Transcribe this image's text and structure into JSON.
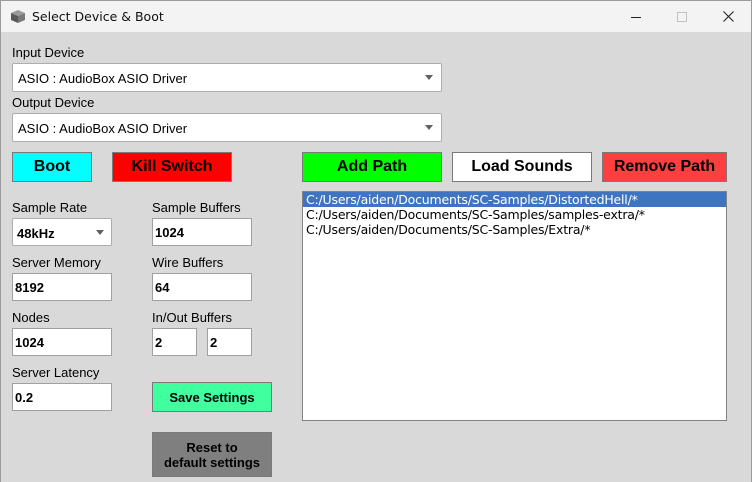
{
  "window": {
    "title": "Select Device & Boot",
    "icon": "app-cube-icon",
    "controls": [
      "minimize-icon",
      "maximize-icon",
      "close-icon"
    ]
  },
  "devices": {
    "input_label": "Input Device",
    "input_value": "ASIO : AudioBox ASIO Driver",
    "output_label": "Output Device",
    "output_value": "ASIO : AudioBox ASIO Driver"
  },
  "actions": {
    "boot": "Boot",
    "kill_switch": "Kill Switch",
    "add_path": "Add Path",
    "load_sounds": "Load Sounds",
    "remove_path": "Remove Path"
  },
  "settings": {
    "sample_rate_label": "Sample Rate",
    "sample_rate_value": "48kHz",
    "sample_buffers_label": "Sample Buffers",
    "sample_buffers_value": "1024",
    "server_memory_label": "Server Memory",
    "server_memory_value": "8192",
    "wire_buffers_label": "Wire Buffers",
    "wire_buffers_value": "64",
    "nodes_label": "Nodes",
    "nodes_value": "1024",
    "io_buffers_label": "In/Out Buffers",
    "in_buffers_value": "2",
    "out_buffers_value": "2",
    "server_latency_label": "Server Latency",
    "server_latency_value": "0.2",
    "save_label": "Save Settings",
    "reset_label_line1": "Reset to",
    "reset_label_line2": "default settings"
  },
  "paths": {
    "items": [
      "C:/Users/aiden/Documents/SC-Samples/DistortedHell/*",
      "C:/Users/aiden/Documents/SC-Samples/samples-extra/*",
      "C:/Users/aiden/Documents/SC-Samples/Extra/*"
    ],
    "selected_index": 0
  },
  "colors": {
    "boot": "#00ffff",
    "kill_switch": "#ff0000",
    "add_path": "#00ff00",
    "load_sounds": "#ffffff",
    "remove_path": "#ff3f3f",
    "save_settings": "#3fff9f",
    "reset": "#7f7f7f",
    "selection": "#3f75c0"
  }
}
